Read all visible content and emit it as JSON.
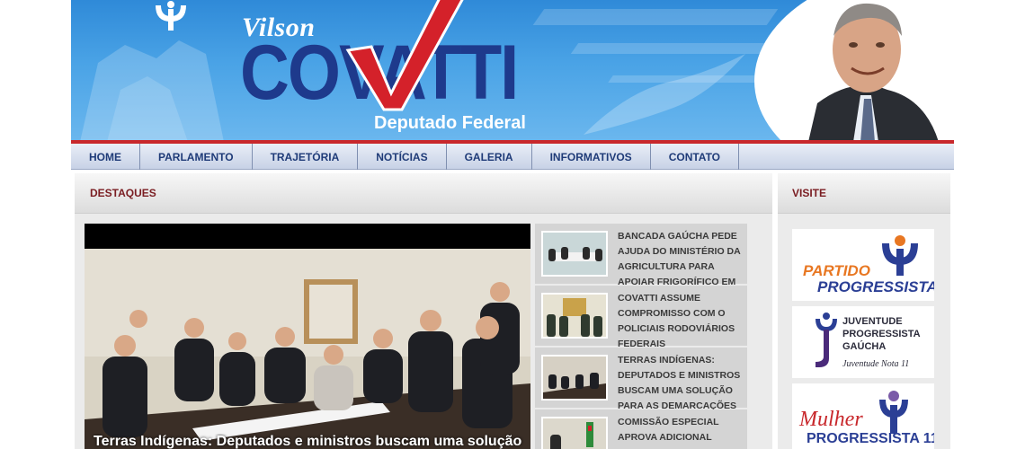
{
  "header": {
    "first_name": "Vilson",
    "last_name": "COVATTI",
    "role": "Deputado Federal"
  },
  "nav": {
    "items": [
      "HOME",
      "PARLAMENTO",
      "TRAJETÓRIA",
      "NOTÍCIAS",
      "GALERIA",
      "INFORMATIVOS",
      "CONTATO"
    ]
  },
  "highlights": {
    "title": "DESTAQUES",
    "feature_caption": "Terras Indígenas: Deputados e ministros buscam uma solução",
    "news": [
      {
        "headline": "BANCADA GAÚCHA PEDE AJUDA DO MINISTÉRIO DA AGRICULTURA PARA APOIAR FRIGORÍFICO EM TRINDADE"
      },
      {
        "headline": "COVATTI ASSUME COMPROMISSO COM O POLICIAIS RODOVIÁRIOS FEDERAIS"
      },
      {
        "headline": "TERRAS INDÍGENAS: DEPUTADOS E MINISTROS BUSCAM UMA SOLUÇÃO PARA AS DEMARCAÇÕES"
      },
      {
        "headline": "COMISSÃO ESPECIAL APROVA ADICIONAL"
      }
    ]
  },
  "visit": {
    "title": "VISITE",
    "banners": [
      {
        "line1": "PARTIDO",
        "line2": "PROGRESSISTA"
      },
      {
        "line1": "JUVENTUDE",
        "line2": "PROGRESSISTA",
        "line3": "GAÚCHA",
        "tagline": "Juventude Nota 11"
      },
      {
        "line1": "Mulher",
        "line2": "PROGRESSISTA 11"
      }
    ]
  },
  "colors": {
    "brand_blue": "#1e3a8c",
    "accent_red": "#c8282c",
    "sky_blue": "#3b95dd",
    "section_title": "#7a1d22"
  }
}
